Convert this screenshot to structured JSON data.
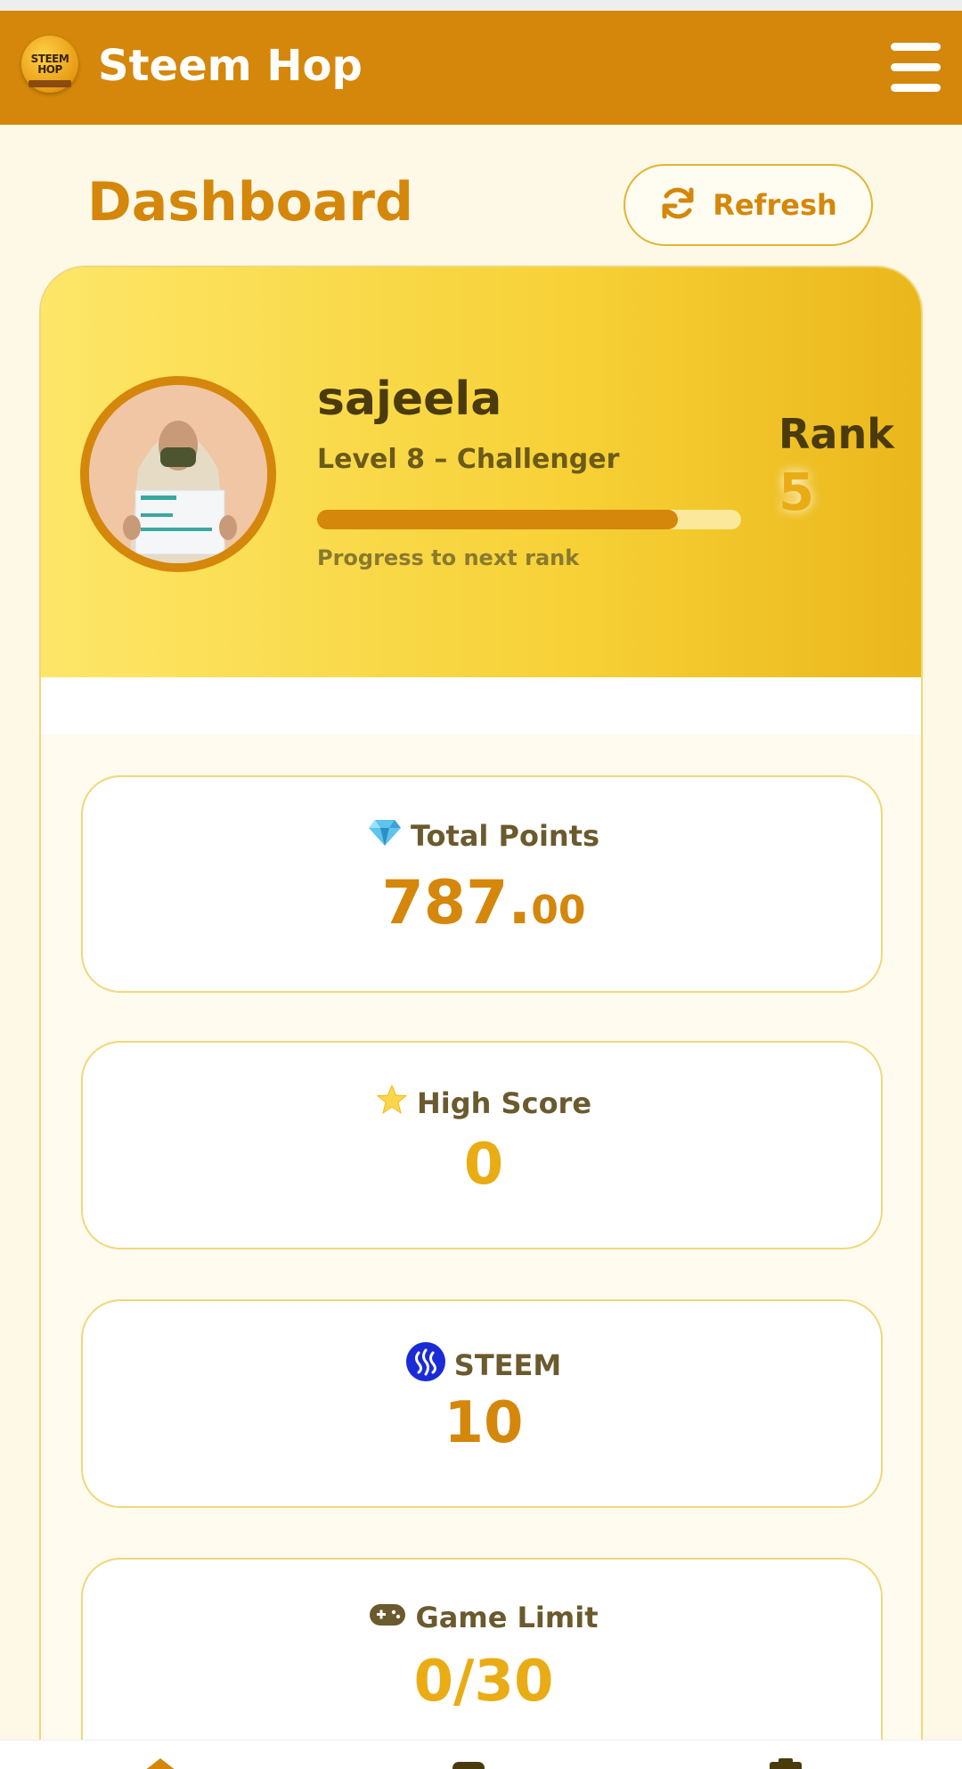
{
  "app": {
    "title": "Steem Hop",
    "logo_text": "STEEM HOP"
  },
  "page": {
    "title": "Dashboard",
    "refresh_label": "Refresh"
  },
  "profile": {
    "username": "sajeela",
    "level": "Level 8 – Challenger",
    "progress_fraction": 0.85,
    "progress_caption": "Progress to next rank",
    "rank_label": "Rank",
    "rank_value": "5"
  },
  "stats": {
    "total_points": {
      "label": "Total Points",
      "value_int": "787.",
      "value_dec": "00",
      "icon": "gem-icon"
    },
    "high_score": {
      "label": "High Score",
      "value": "0",
      "icon": "star-icon"
    },
    "steem": {
      "label": "STEEM",
      "value": "10",
      "icon": "steem-icon"
    },
    "game_limit": {
      "label": "Game Limit",
      "value": "0/30",
      "icon": "gamepad-icon"
    }
  },
  "colors": {
    "brand": "#d4870a",
    "gold": "#e9ac14",
    "steem_blue": "#1a2bd6"
  }
}
